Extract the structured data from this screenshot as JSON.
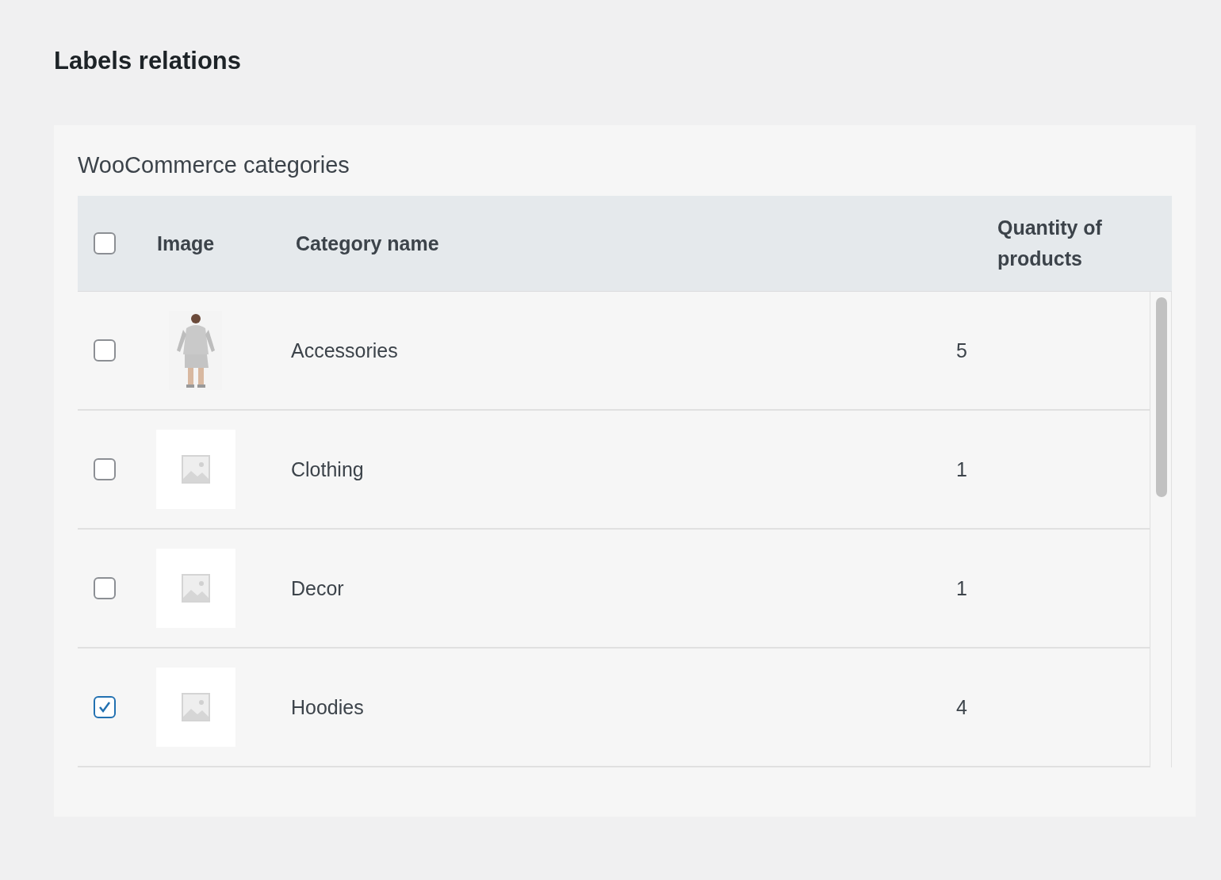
{
  "page_title": "Labels relations",
  "section": {
    "title": "WooCommerce categories",
    "table": {
      "select_all": {
        "checked": false
      },
      "columns": [
        "Image",
        "Category name",
        "Quantity of products"
      ],
      "rows": [
        {
          "checked": false,
          "name": "Accessories",
          "quantity": "5"
        },
        {
          "checked": false,
          "image": {
            "kind": "placeholder"
          },
          "name": "Clothing",
          "quantity": "1"
        },
        {
          "checked": false,
          "image": {
            "kind": "placeholder"
          },
          "name": "Decor",
          "quantity": "1"
        },
        {
          "checked": true,
          "image": {
            "kind": "placeholder"
          },
          "name": "Hoodies",
          "quantity": "4"
        }
      ]
    }
  }
}
